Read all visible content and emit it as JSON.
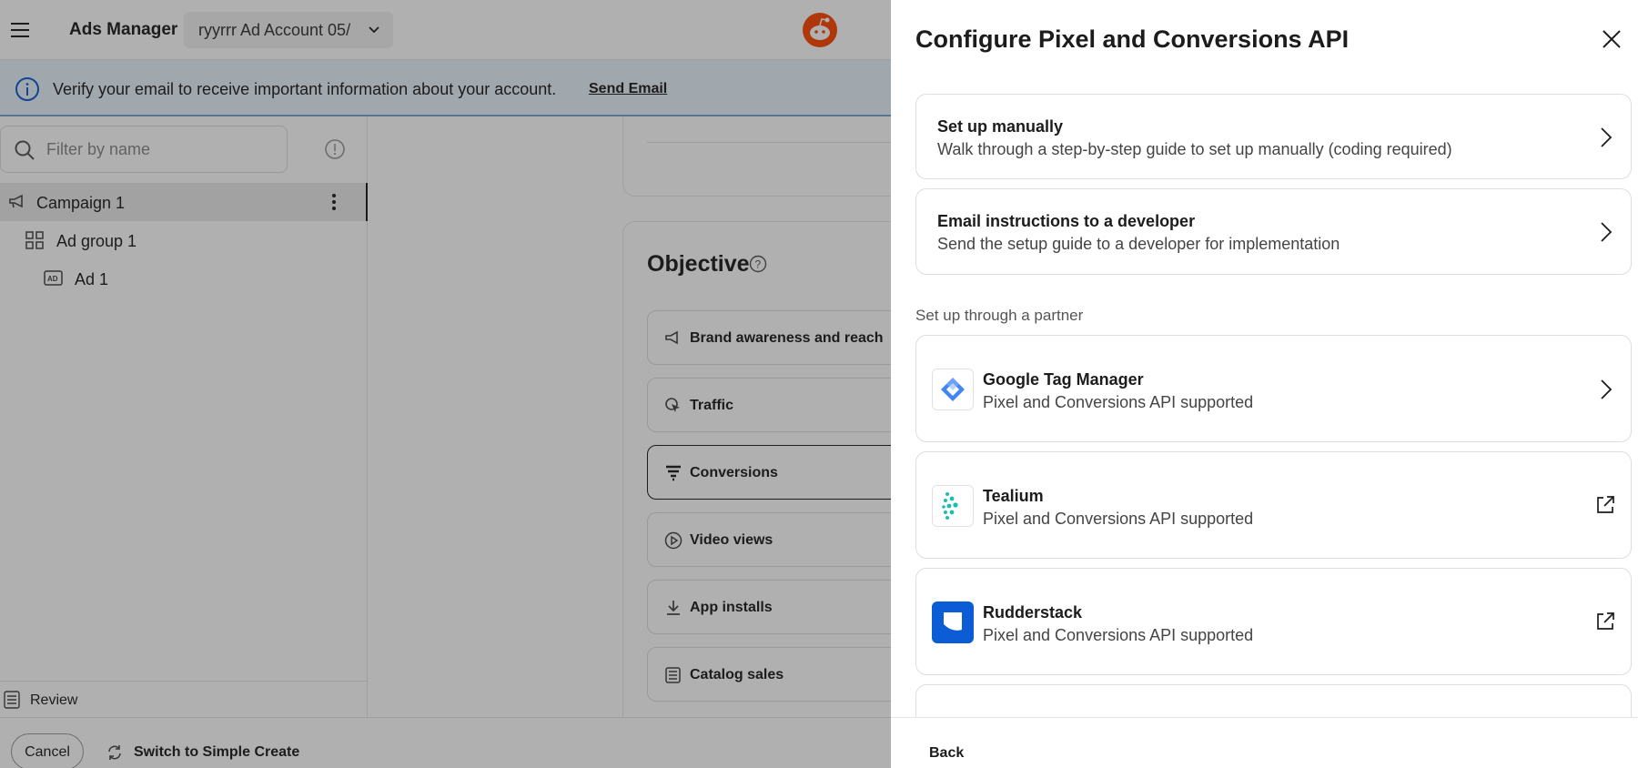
{
  "header": {
    "title": "Ads Manager",
    "account": "ryyrrr Ad Account 05/"
  },
  "banner": {
    "message": "Verify your email to receive important information about your account.",
    "link": "Send Email"
  },
  "sidebar": {
    "filter_placeholder": "Filter by name",
    "items": [
      {
        "label": "Campaign 1",
        "icon": "megaphone-icon"
      },
      {
        "label": "Ad group 1",
        "icon": "grid-icon"
      },
      {
        "label": "Ad 1",
        "icon": "ad-icon"
      }
    ],
    "review": "Review"
  },
  "objective": {
    "title": "Objective",
    "options": [
      {
        "label": "Brand awareness and reach",
        "icon": "megaphone-icon"
      },
      {
        "label": "Traffic",
        "icon": "click-icon"
      },
      {
        "label": "Conversions",
        "icon": "funnel-icon"
      },
      {
        "label": "Video views",
        "icon": "play-icon"
      },
      {
        "label": "App installs",
        "icon": "download-icon"
      },
      {
        "label": "Catalog sales",
        "icon": "catalog-icon"
      }
    ]
  },
  "footer": {
    "cancel": "Cancel",
    "switch": "Switch to Simple Create"
  },
  "drawer": {
    "title": "Configure Pixel and Conversions API",
    "manual": {
      "title": "Set up manually",
      "subtitle": "Walk through a step-by-step guide to set up manually (coding required)"
    },
    "email": {
      "title": "Email instructions to a developer",
      "subtitle": "Send the setup guide to a developer for implementation"
    },
    "partner_label": "Set up through a partner",
    "partners": [
      {
        "name": "Google Tag Manager",
        "subtitle": "Pixel and Conversions API supported",
        "action": "chevron-right-icon"
      },
      {
        "name": "Tealium",
        "subtitle": "Pixel and Conversions API supported",
        "action": "external-link-icon"
      },
      {
        "name": "Rudderstack",
        "subtitle": "Pixel and Conversions API supported",
        "action": "external-link-icon"
      }
    ],
    "back": "Back"
  },
  "colors": {
    "accent_blue": "#0b5cd5",
    "reddit_orange": "#ff4500",
    "tealium_teal": "#1bbfb0",
    "gtm_blue": "#4285f4"
  }
}
